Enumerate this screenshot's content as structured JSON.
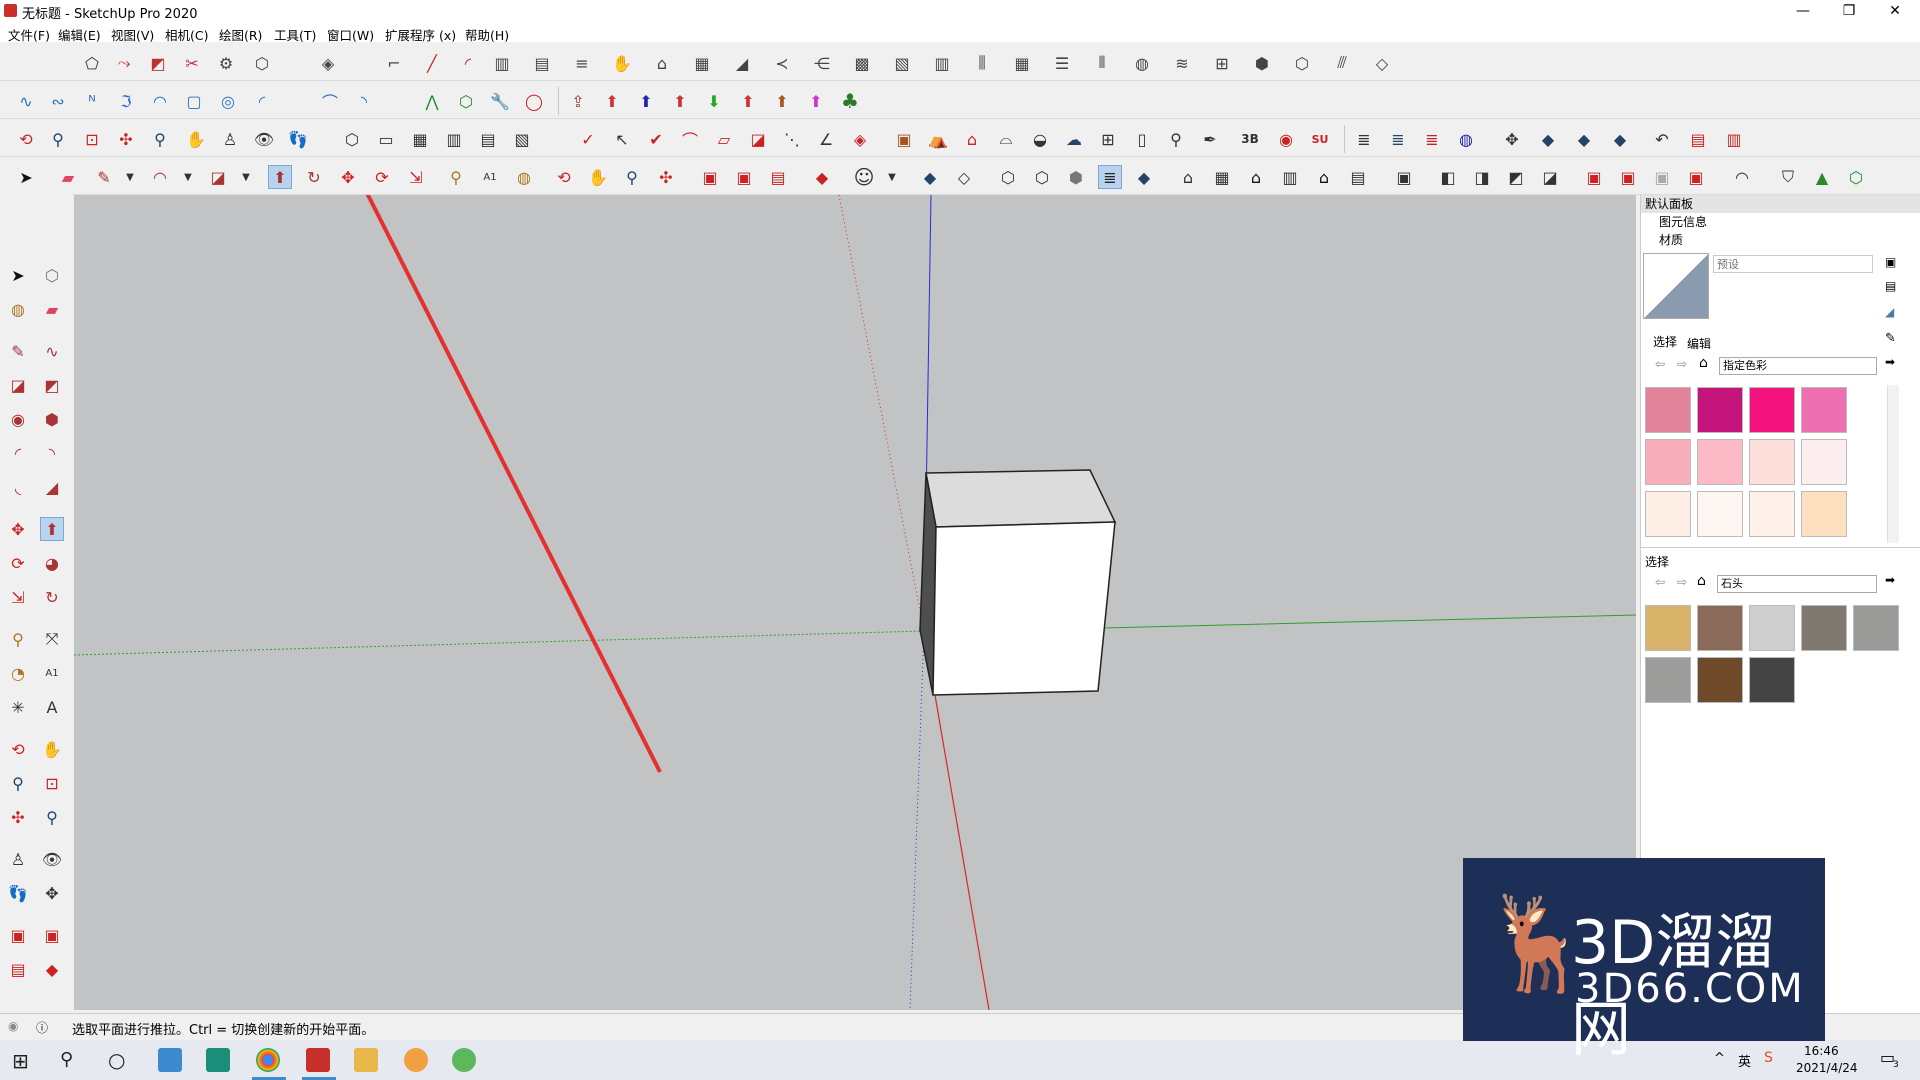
{
  "window": {
    "title": "无标题 - SketchUp Pro 2020",
    "minimize": "—",
    "maximize": "❐",
    "close": "✕"
  },
  "menu": [
    "文件(F)",
    "编辑(E)",
    "视图(V)",
    "相机(C)",
    "绘图(R)",
    "工具(T)",
    "窗口(W)",
    "扩展程序 (x)",
    "帮助(H)"
  ],
  "panel": {
    "title": "默认面板",
    "sections": [
      "图元信息",
      "材质"
    ],
    "preset_placeholder": "预设",
    "tabs": [
      "选择",
      "编辑"
    ],
    "library1": "指定色彩",
    "library2_label": "选择",
    "library2": "石头",
    "colors1": [
      "#e0829a",
      "#c2147a",
      "#f4127e",
      "#ee6fb0",
      "#f9aebb",
      "#fbbac6",
      "#fde0dc",
      "#fdeef0",
      "#fdeee6",
      "#fdf6f2",
      "#fdf1ea",
      "#fde0c0"
    ],
    "colors2": [
      "#d8b46a",
      "#8a6a58",
      "#cfcfcf",
      "#7f7870",
      "#9a9a98",
      "#9c9c9a",
      "#6e4a2a",
      "#444444"
    ]
  },
  "status": {
    "message": "选取平面进行推拉。Ctrl = 切换创建新的开始平面。"
  },
  "taskbar": {
    "time": "16:46",
    "date": "2021/4/24",
    "lang": "英",
    "notif": "3"
  },
  "watermark": {
    "brand": "3D溜溜网",
    "url": "3D66.COM"
  },
  "colors": {
    "axis_red": "#d62a2a",
    "axis_green": "#2e9e2e",
    "axis_blue": "#2a2ad6",
    "viewport_bg": "#c2c3c5",
    "arrow": "#e53030"
  }
}
